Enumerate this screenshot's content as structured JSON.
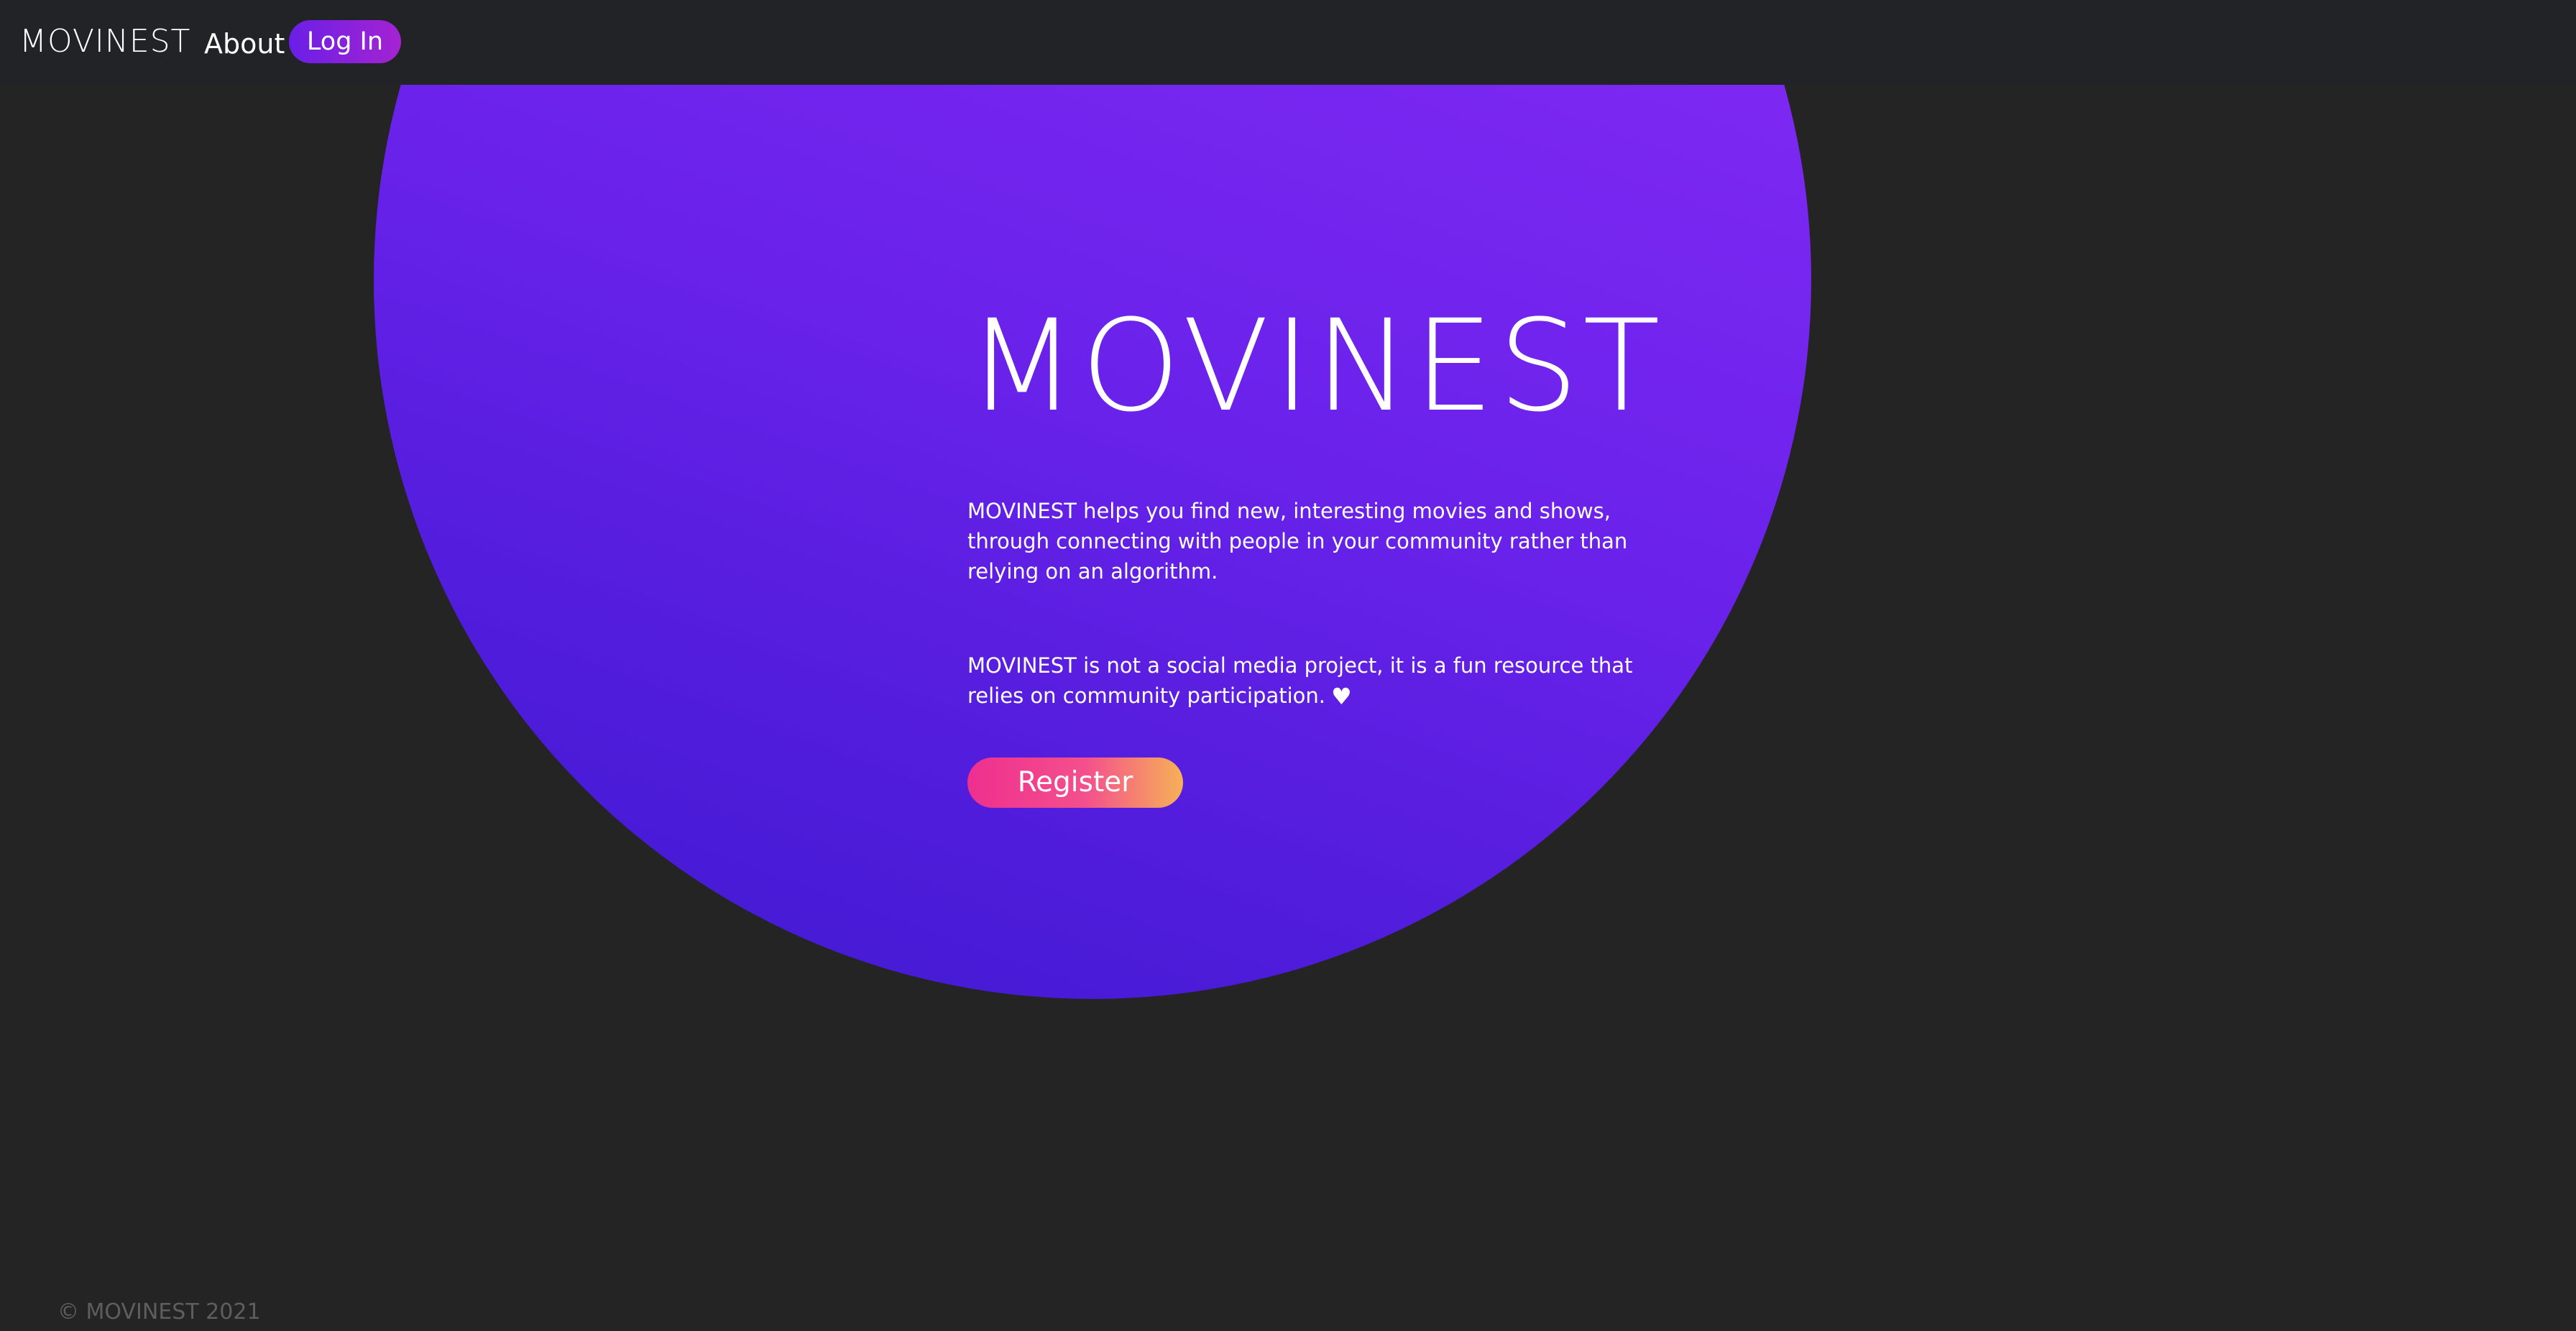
{
  "navbar": {
    "brand": "MOVINEST",
    "about_label": "About",
    "login_label": "Log In"
  },
  "hero": {
    "title": "MOVINEST",
    "description": "MOVINEST helps you find new, interesting movies and shows, through connecting with people in your community rather than relying on an algorithm.",
    "note": "MOVINEST is not a social media project, it is a fun resource that relies on community participation.",
    "heart_icon": "heart-icon",
    "heart_glyph": "♥",
    "register_label": "Register"
  },
  "footer": {
    "copyright": "© MOVINEST 2021"
  },
  "colors": {
    "background": "#242424",
    "navbar": "#222326",
    "circle_top": "#b526c9",
    "circle_mid": "#7c28f2",
    "circle_bottom": "#421ad4",
    "login_start": "#6a1fe6",
    "login_end": "#a523d2",
    "register_start": "#ee2f8f",
    "register_end": "#f6b157",
    "footer_text": "#5e5e5e"
  }
}
